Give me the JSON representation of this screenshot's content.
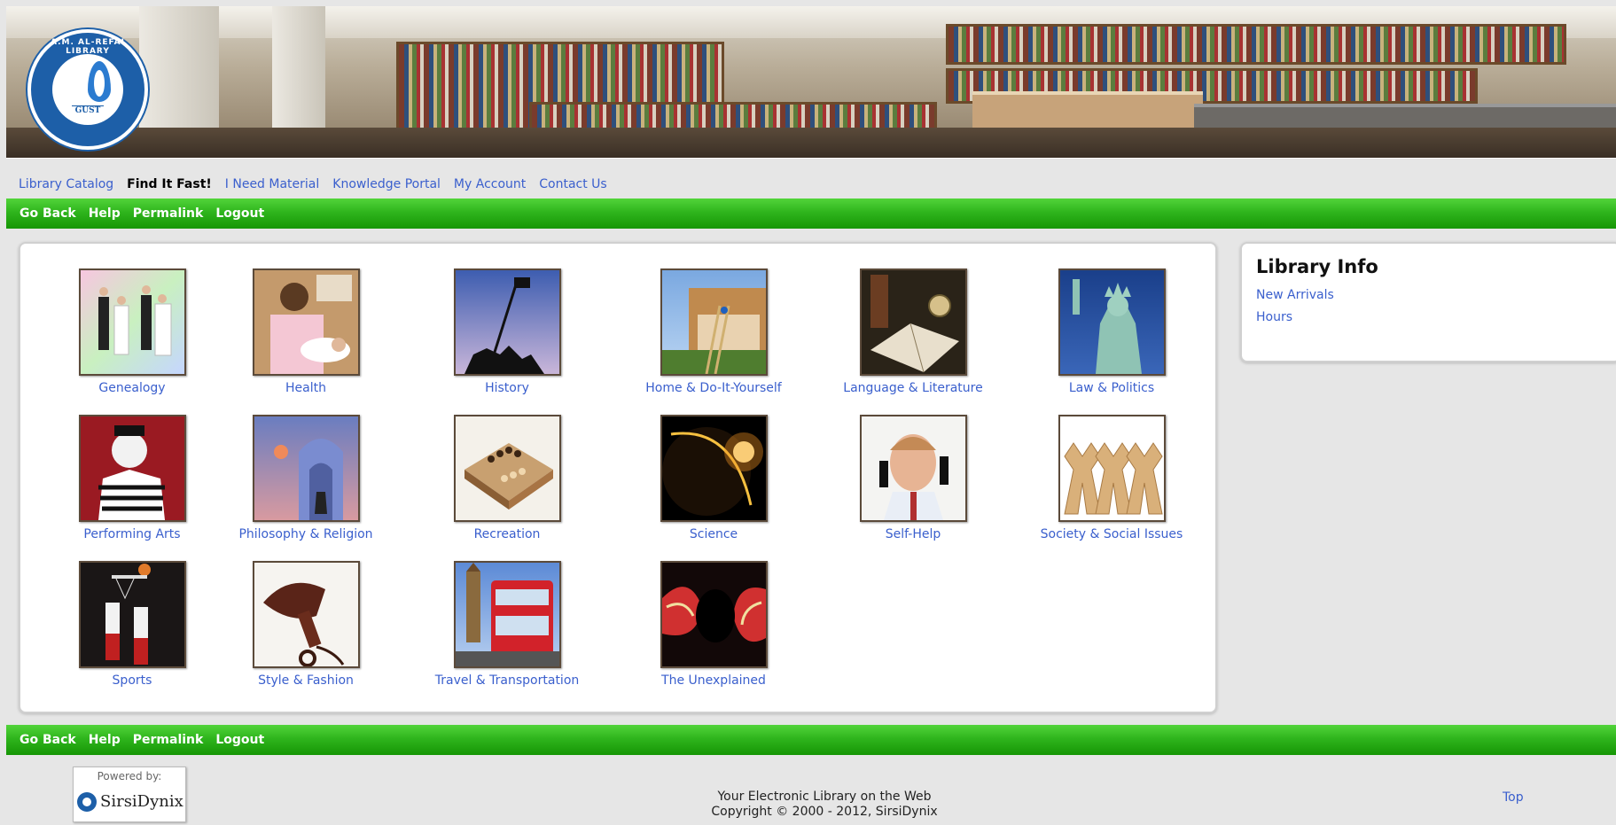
{
  "banner": {
    "logo_ring_text": "A.M. AL-REFAI LIBRARY",
    "logo_name": "GUST"
  },
  "topnav": [
    {
      "label": "Library Catalog",
      "active": false
    },
    {
      "label": "Find It Fast!",
      "active": true
    },
    {
      "label": "I Need Material",
      "active": false
    },
    {
      "label": "Knowledge Portal",
      "active": false
    },
    {
      "label": "My Account",
      "active": false
    },
    {
      "label": "Contact Us",
      "active": false
    }
  ],
  "actionbar": {
    "go_back": "Go Back",
    "help": "Help",
    "permalink": "Permalink",
    "logout": "Logout"
  },
  "categories": [
    {
      "label": "Genealogy",
      "icon": "wedding-couples-icon"
    },
    {
      "label": "Health",
      "icon": "nurse-baby-icon"
    },
    {
      "label": "History",
      "icon": "flag-raising-icon"
    },
    {
      "label": "Home & Do-It-Yourself",
      "icon": "house-ladder-icon"
    },
    {
      "label": "Language & Literature",
      "icon": "open-book-icon"
    },
    {
      "label": "Law & Politics",
      "icon": "statue-of-liberty-icon"
    },
    {
      "label": "Performing Arts",
      "icon": "mime-icon"
    },
    {
      "label": "Philosophy & Religion",
      "icon": "bell-tower-icon"
    },
    {
      "label": "Recreation",
      "icon": "chessboard-icon"
    },
    {
      "label": "Science",
      "icon": "eclipse-icon"
    },
    {
      "label": "Self-Help",
      "icon": "man-phones-icon"
    },
    {
      "label": "Society & Social Issues",
      "icon": "paper-dolls-icon"
    },
    {
      "label": "Sports",
      "icon": "basketball-icon"
    },
    {
      "label": "Style & Fashion",
      "icon": "hair-dryer-icon"
    },
    {
      "label": "Travel & Transportation",
      "icon": "double-decker-bus-icon"
    },
    {
      "label": "The Unexplained",
      "icon": "abstract-swirl-icon"
    }
  ],
  "library_info": {
    "title": "Library Info",
    "links": [
      "New Arrivals",
      "Hours"
    ]
  },
  "footer": {
    "powered_by": "Powered by:",
    "vendor": "SirsiDynix",
    "line1": "Your Electronic Library on the Web",
    "line2": "Copyright © 2000 - 2012, SirsiDynix",
    "top": "Top"
  }
}
